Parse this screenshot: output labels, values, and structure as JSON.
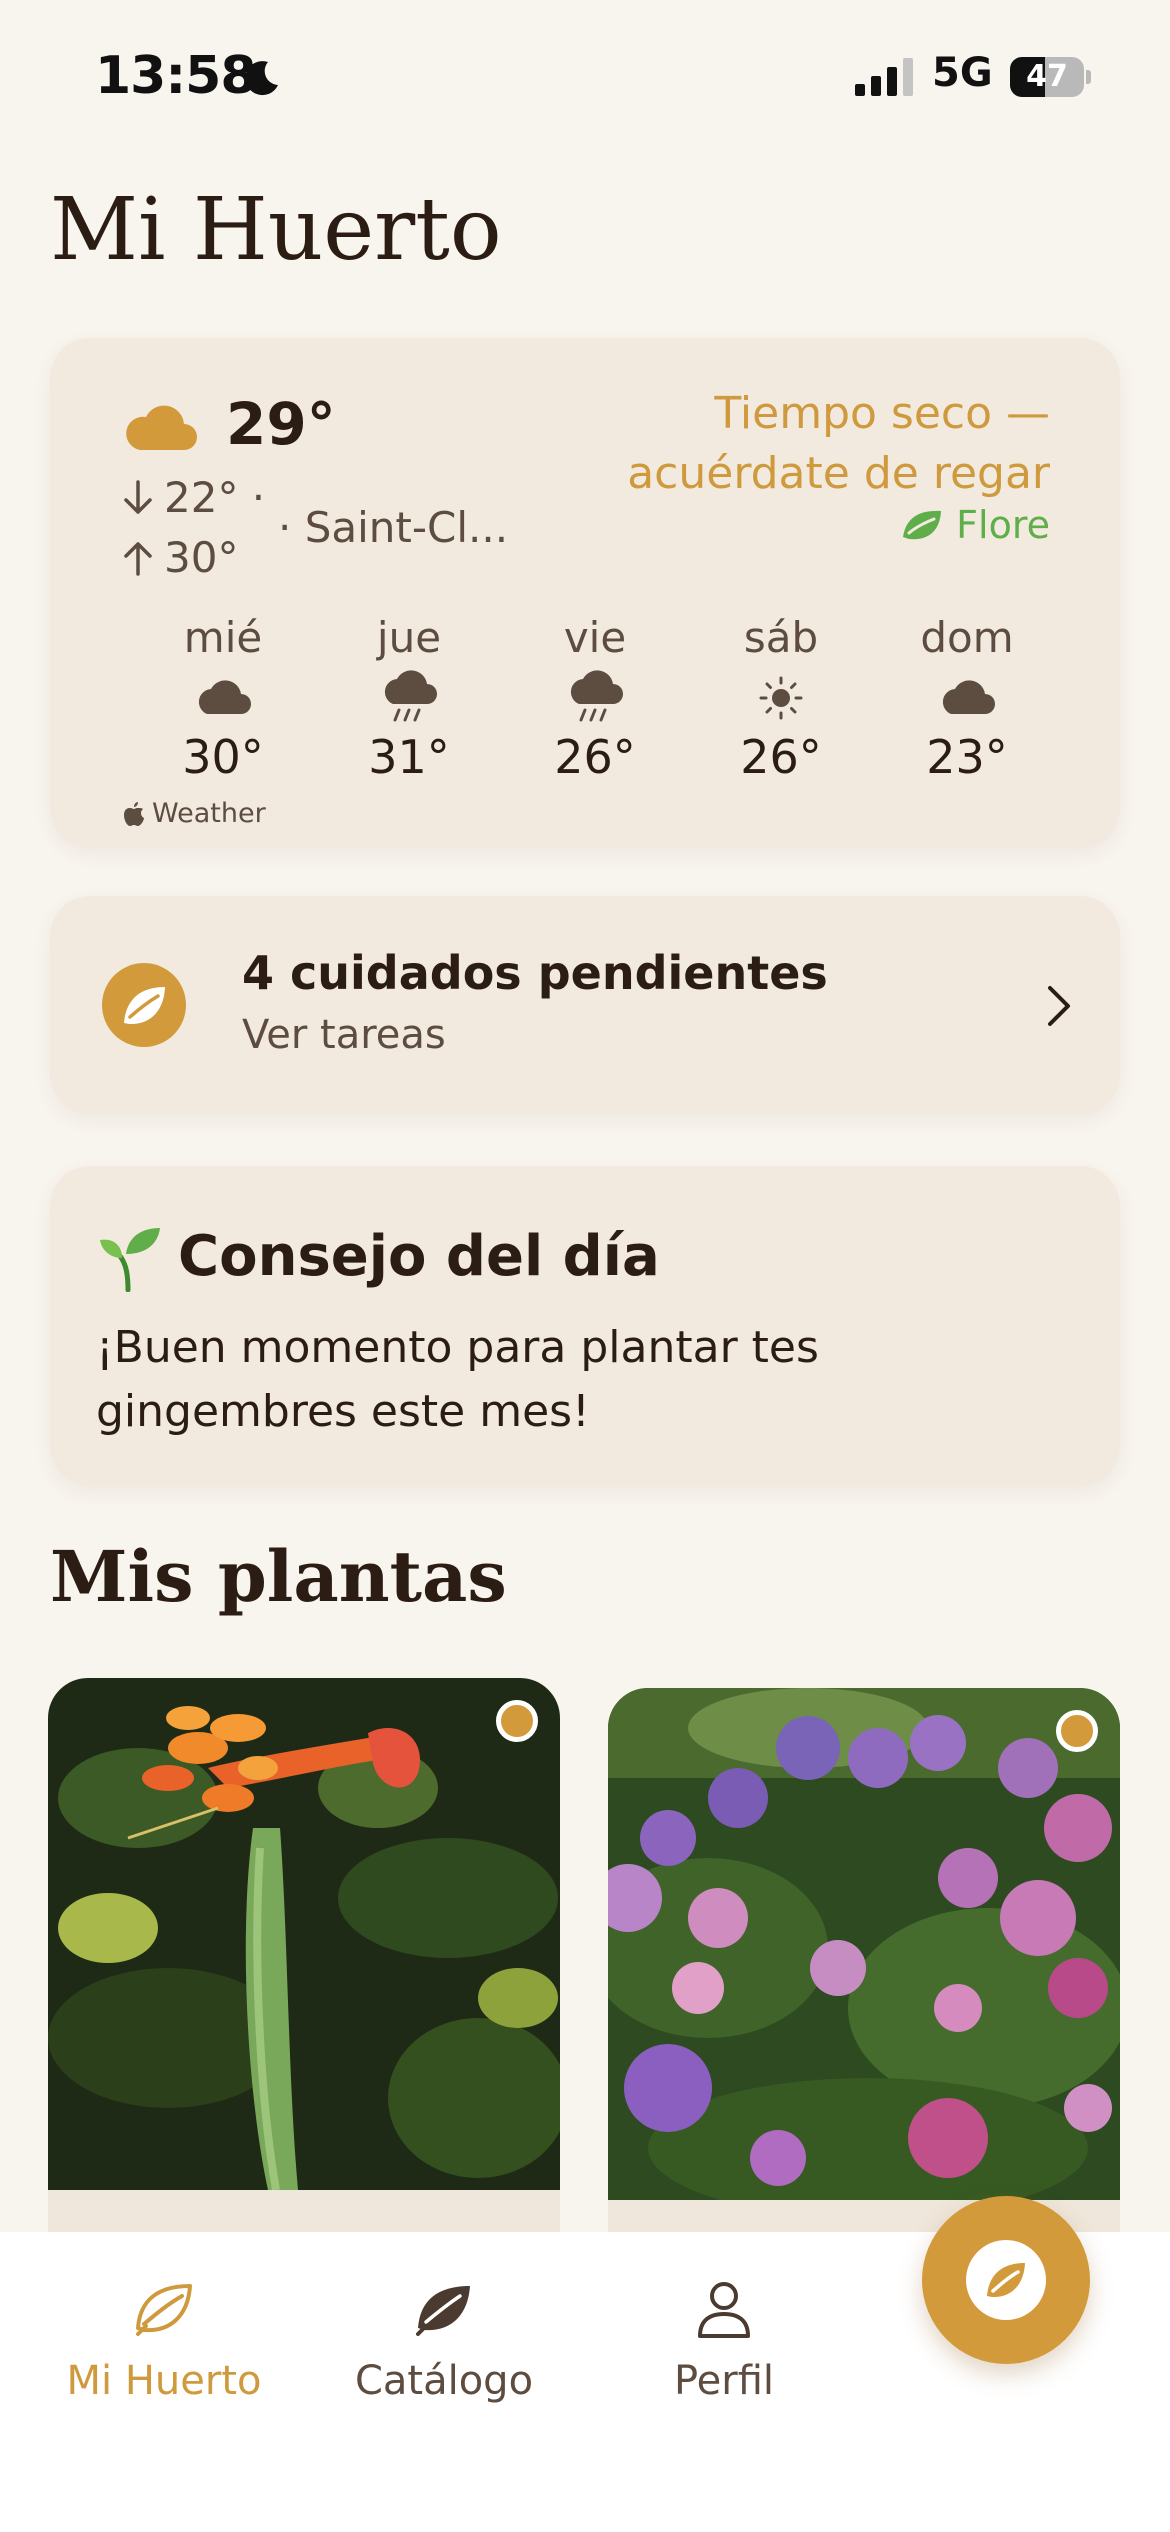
{
  "status_bar": {
    "time": "13:58",
    "network": "5G",
    "battery": "47",
    "battery_level": 0.47
  },
  "page_title": "Mi Huerto",
  "weather": {
    "current_temp": "29°",
    "min": "22° ·",
    "max": "30°",
    "location": "· Saint-Cl...",
    "advice_line1": "Tiempo seco —",
    "advice_line2": "acuérdate de regar",
    "source_name": "Flore",
    "forecast": [
      {
        "day": "mié",
        "icon": "cloud-icon",
        "temp": "30°"
      },
      {
        "day": "jue",
        "icon": "rain-icon",
        "temp": "31°"
      },
      {
        "day": "vie",
        "icon": "rain-icon",
        "temp": "26°"
      },
      {
        "day": "sáb",
        "icon": "sun-icon",
        "temp": "26°"
      },
      {
        "day": "dom",
        "icon": "cloud-icon",
        "temp": "23°"
      }
    ],
    "attribution": "Weather"
  },
  "tasks": {
    "title": "4 cuidados pendientes",
    "subtitle": "Ver tareas"
  },
  "tip": {
    "title": "Consejo del día",
    "body": "¡Buen momento para plantar tes gingembres este mes!"
  },
  "plants_section_title": "Mis plantas",
  "plants": [
    {
      "icon": "trumpet-vine-photo"
    },
    {
      "icon": "hydrangea-photo"
    }
  ],
  "tab_bar": {
    "items": [
      {
        "label": "Mi Huerto",
        "icon": "leaf-outline-icon",
        "active": true
      },
      {
        "label": "Catálogo",
        "icon": "leaf-filled-icon",
        "active": false
      },
      {
        "label": "Perfil",
        "icon": "person-icon",
        "active": false
      }
    ]
  },
  "colors": {
    "accent": "#d39a3c",
    "background": "#f8f4ee",
    "card": "#f2eadf",
    "text": "#2b1d14",
    "green": "#5fae4a"
  }
}
